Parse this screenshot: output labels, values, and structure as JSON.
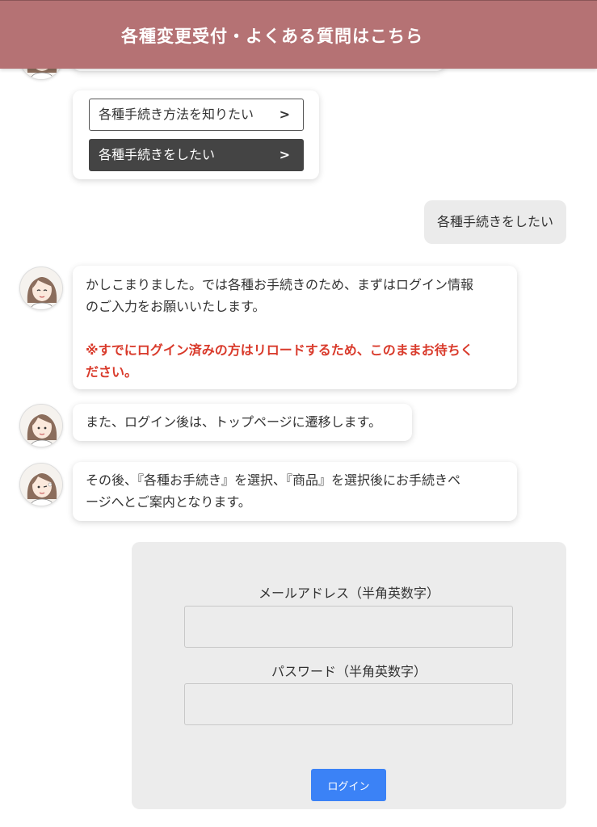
{
  "header": {
    "title": "各種変更受付・よくある質問はこちら"
  },
  "choices": [
    {
      "label": "各種手続き方法を知りたい",
      "icon": "chevron-right-icon"
    },
    {
      "label": "各種手続きをしたい",
      "icon": "chevron-right-icon"
    }
  ],
  "user_message": "各種手続きをしたい",
  "bot_messages": [
    {
      "line1": "かしこまりました。では各種お手続きのため、まずはログイン情報",
      "line2": "のご入力をお願いいたします。",
      "warn_line1": "※すでにログイン済みの方はリロードするため、このままお待ちく",
      "warn_line2": "ださい。"
    },
    {
      "line1": "また、ログイン後は、トップページに遷移します。"
    },
    {
      "line1": "その後、『各種お手続き』を選択、『商品』を選択後にお手続きペ",
      "line2": "ージへとご案内となります。"
    }
  ],
  "login_form": {
    "email_label": "メールアドレス（半角英数字）",
    "email_value": "",
    "password_label": "パスワード（半角英数字）",
    "password_value": "",
    "submit_label": "ログイン"
  },
  "colors": {
    "header_bg": "#b57274",
    "warning_text": "#d93a2b",
    "login_button": "#3b82f6",
    "dark_choice": "#444444"
  }
}
